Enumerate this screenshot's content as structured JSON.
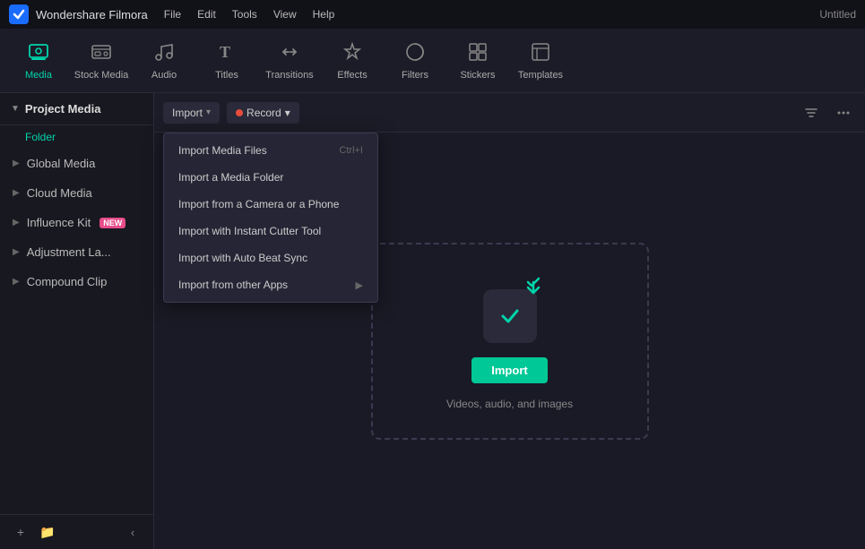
{
  "app": {
    "name": "Wondershare Filmora",
    "title_right": "Untitled"
  },
  "menu_bar": {
    "items": [
      "File",
      "Edit",
      "Tools",
      "View",
      "Help"
    ]
  },
  "toolbar": {
    "tools": [
      {
        "id": "media",
        "label": "Media",
        "icon": "⊞",
        "active": true
      },
      {
        "id": "stock-media",
        "label": "Stock Media",
        "icon": "🎞",
        "active": false
      },
      {
        "id": "audio",
        "label": "Audio",
        "icon": "♪",
        "active": false
      },
      {
        "id": "titles",
        "label": "Titles",
        "icon": "T",
        "active": false
      },
      {
        "id": "transitions",
        "label": "Transitions",
        "icon": "⇄",
        "active": false
      },
      {
        "id": "effects",
        "label": "Effects",
        "icon": "✦",
        "active": false
      },
      {
        "id": "filters",
        "label": "Filters",
        "icon": "◈",
        "active": false
      },
      {
        "id": "stickers",
        "label": "Stickers",
        "icon": "◉",
        "active": false
      },
      {
        "id": "templates",
        "label": "Templates",
        "icon": "▦",
        "active": false
      }
    ]
  },
  "sidebar": {
    "header_label": "Project Media",
    "folder_label": "Folder",
    "items": [
      {
        "id": "global-media",
        "label": "Global Media",
        "badge": null
      },
      {
        "id": "cloud-media",
        "label": "Cloud Media",
        "badge": null
      },
      {
        "id": "influence-kit",
        "label": "Influence Kit",
        "badge": "NEW"
      },
      {
        "id": "adjustment-la",
        "label": "Adjustment La...",
        "badge": null
      },
      {
        "id": "compound-clip",
        "label": "Compound Clip",
        "badge": null
      }
    ],
    "footer": {
      "add_folder_label": "+",
      "new_folder_label": "📁",
      "collapse_label": "‹"
    }
  },
  "content_toolbar": {
    "import_label": "Import",
    "record_label": "Record",
    "filter_icon": "filter",
    "more_icon": "more"
  },
  "dropdown_menu": {
    "items": [
      {
        "id": "import-media-files",
        "label": "Import Media Files",
        "shortcut": "Ctrl+I",
        "has_submenu": false
      },
      {
        "id": "import-media-folder",
        "label": "Import a Media Folder",
        "shortcut": "",
        "has_submenu": false
      },
      {
        "id": "import-camera-phone",
        "label": "Import from a Camera or a Phone",
        "shortcut": "",
        "has_submenu": false
      },
      {
        "id": "import-instant-cutter",
        "label": "Import with Instant Cutter Tool",
        "shortcut": "",
        "has_submenu": false
      },
      {
        "id": "import-auto-beat",
        "label": "Import with Auto Beat Sync",
        "shortcut": "",
        "has_submenu": false
      },
      {
        "id": "import-other-apps",
        "label": "Import from other Apps",
        "shortcut": "",
        "has_submenu": true
      }
    ]
  },
  "import_area": {
    "button_label": "Import",
    "subtitle": "Videos, audio, and images"
  }
}
